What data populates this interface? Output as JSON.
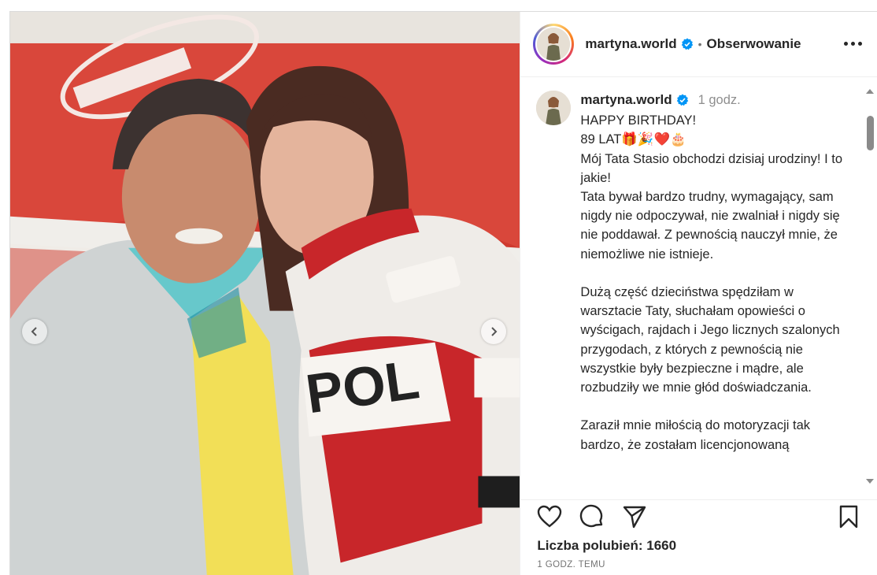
{
  "header": {
    "username": "martyna.world",
    "separator": "•",
    "follow_state": "Obserwowanie"
  },
  "caption": {
    "username": "martyna.world",
    "time": "1 godz.",
    "text": "HAPPY BIRTHDAY!\n89 LAT🎁🎉❤️🎂\nMój Tata Stasio obchodzi dzisiaj urodziny! I to jakie!\nTata bywał bardzo trudny, wymagający, sam nigdy nie odpoczywał, nie zwalniał i nigdy się nie poddawał. Z pewnością nauczył mnie, że niemożliwe nie istnieje.\n\nDużą część dzieciństwa spędziłam w warsztacie Taty, słuchałam opowieści o wyścigach, rajdach i Jego licznych szalonych przygodach, z których z pewnością nie wszystkie były bezpieczne i mądre, ale rozbudziły we mnie głód doświadczania.\n\nZaraził mnie miłością do motoryzacji tak bardzo, że zostałam licencjonowaną"
  },
  "likes": "Liczba polubień: 1660",
  "time_ago": "1 GODZ. TEMU",
  "icons": {
    "verified": "verified-badge-icon",
    "more": "more-options-icon",
    "like": "heart-icon",
    "comment": "comment-icon",
    "share": "send-icon",
    "save": "bookmark-icon",
    "prev": "chevron-left-icon",
    "next": "chevron-right-icon"
  },
  "colors": {
    "verified": "#0095f6",
    "text": "#262626",
    "muted": "#737373"
  }
}
